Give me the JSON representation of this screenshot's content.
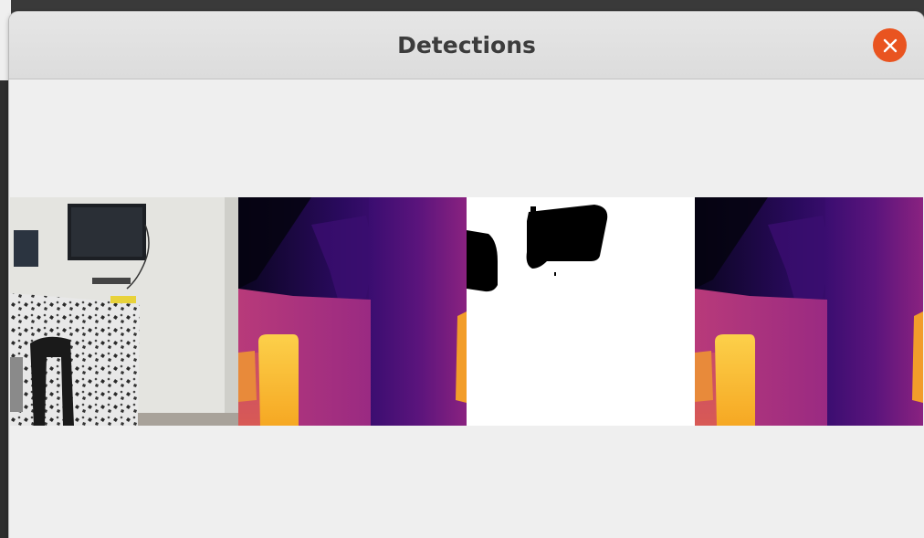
{
  "window": {
    "title": "Detections",
    "close_icon": "close-icon",
    "accent_color": "#e95420"
  },
  "panels": [
    {
      "name": "rgb-frame",
      "kind": "camera image"
    },
    {
      "name": "depth-map",
      "kind": "depth colormap (inferno)"
    },
    {
      "name": "obstacle-mask",
      "kind": "binary mask"
    },
    {
      "name": "depth-map-copy",
      "kind": "depth colormap (inferno)"
    }
  ]
}
